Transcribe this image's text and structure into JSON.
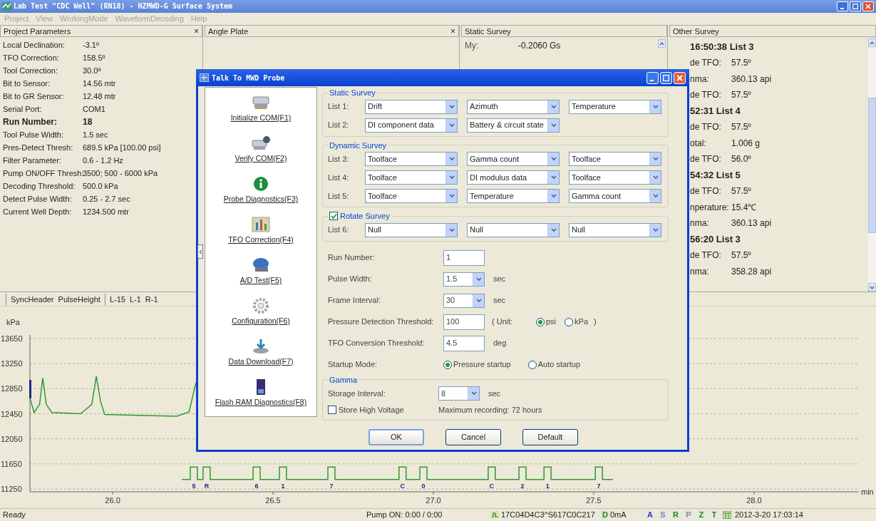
{
  "window": {
    "title": "Lab Test \"CDC Well\" (RN18) - HZMWD-G Surface System"
  },
  "menu": [
    "Project",
    "View",
    "WorkingMode",
    "WaveformDecoding",
    "Help"
  ],
  "project_parameters": {
    "title": "Project Parameters",
    "close": "×",
    "rows": [
      {
        "label": "Local Declination:",
        "value": "-3.1º",
        "bold": false
      },
      {
        "label": "TFO Correction:",
        "value": "158.5º",
        "bold": false
      },
      {
        "label": "Tool Correction:",
        "value": "30.0º",
        "bold": false
      },
      {
        "label": "Bit to Sensor:",
        "value": "14.56 mtr",
        "bold": false
      },
      {
        "label": "Bit to GR Sensor:",
        "value": "12.48 mtr",
        "bold": false
      },
      {
        "label": "Serial Port:",
        "value": "COM1",
        "bold": false
      },
      {
        "label": "Run Number:",
        "value": "18",
        "bold": true
      },
      {
        "label": "Tool Pulse Width:",
        "value": "1.5 sec",
        "bold": false
      },
      {
        "label": "Pres-Detect Thresh:",
        "value": "689.5 kPa [100.00 psi]",
        "bold": false
      },
      {
        "label": "Filter Parameter:",
        "value": "0.6 - 1.2 Hz",
        "bold": false
      },
      {
        "label": "Pump ON/OFF Thresh:",
        "value": "3500; 500 - 6000 kPa",
        "bold": false
      },
      {
        "label": "Decoding Threshold:",
        "value": "500.0 kPa",
        "bold": false
      },
      {
        "label": "Detect Pulse Width:",
        "value": "0.25 - 2.7 sec",
        "bold": false
      },
      {
        "label": "Current Well Depth:",
        "value": "1234.500 mtr",
        "bold": false
      }
    ]
  },
  "angle_plate": {
    "title": "Angle Plate",
    "close": "×"
  },
  "static_survey": {
    "title": "Static Survey",
    "rows": [
      {
        "label": "My:",
        "value": "-0.2060 Gs"
      }
    ]
  },
  "other_survey": {
    "title": "Other Survey",
    "entries": [
      {
        "kind": "header",
        "text": "16:50:38 List 3"
      },
      {
        "kind": "value",
        "label": "de TFO:",
        "value": "57.5º"
      },
      {
        "kind": "value",
        "label": "nma:",
        "value": "360.13 api"
      },
      {
        "kind": "value",
        "label": "de TFO:",
        "value": "57.5º"
      },
      {
        "kind": "header",
        "text": "52:31 List 4"
      },
      {
        "kind": "value",
        "label": "de TFO:",
        "value": "57.5º"
      },
      {
        "kind": "value",
        "label": "otal:",
        "value": "1.006 g"
      },
      {
        "kind": "value",
        "label": "de TFO:",
        "value": "56.0º"
      },
      {
        "kind": "header",
        "text": "54:32 List 5"
      },
      {
        "kind": "value",
        "label": "de TFO:",
        "value": "57.5º"
      },
      {
        "kind": "value",
        "label": "nperature:",
        "value": "15.4℃"
      },
      {
        "kind": "value",
        "label": "nma:",
        "value": "360.13 api"
      },
      {
        "kind": "header",
        "text": "56:20 List 3"
      },
      {
        "kind": "value",
        "label": "de TFO:",
        "value": "57.5º"
      },
      {
        "kind": "value",
        "label": "nma:",
        "value": "358.28 api"
      }
    ]
  },
  "chart_panel": {
    "legend": [
      "SyncHeader",
      "PulseHeight",
      "L-15",
      "L-1",
      "R-1"
    ],
    "chart_data": {
      "type": "line",
      "grid": true,
      "xlabel": "min",
      "ylabel": "kPa",
      "xlim": [
        25.742,
        28.327
      ],
      "ylim": [
        11250,
        13650
      ],
      "xticks": [
        {
          "value": 26,
          "label": "26.0"
        },
        {
          "value": 26.5,
          "label": "26.5"
        },
        {
          "value": 27,
          "label": "27.0"
        },
        {
          "value": 27.5,
          "label": "27.5"
        },
        {
          "value": 28,
          "label": "28.0"
        }
      ],
      "yticks": [
        13650,
        13250,
        12850,
        12450,
        12050,
        11650,
        11250
      ],
      "x": [
        25.742,
        25.755,
        25.772,
        25.782,
        25.793,
        25.81,
        25.9,
        25.935,
        25.949,
        25.962,
        25.975,
        26.1,
        26.2,
        26.238,
        26.26
      ],
      "series": [
        {
          "color": "#2f9a2f",
          "values": [
            12700,
            12470,
            12600,
            13020,
            12600,
            12470,
            12450,
            12600,
            13050,
            12650,
            12440,
            12420,
            12410,
            12480,
            12950
          ]
        },
        {
          "color": "#2f9a2f",
          "x": [
            26.216,
            26.242,
            26.242,
            26.264,
            26.264,
            26.282,
            26.282,
            26.304,
            26.304,
            26.438,
            26.438,
            26.46,
            26.46,
            26.52,
            26.52,
            26.542,
            26.542,
            26.671,
            26.671,
            26.693,
            26.693,
            26.893,
            26.893,
            26.915,
            26.915,
            26.958,
            26.958,
            26.98,
            26.98,
            27.171,
            27.171,
            27.193,
            27.193,
            27.267,
            27.267,
            27.289,
            27.289,
            27.345,
            27.345,
            27.367,
            27.367,
            27.505,
            27.505,
            27.527,
            27.527,
            27.56
          ],
          "values": [
            11400,
            11400,
            11600,
            11600,
            11400,
            11400,
            11600,
            11600,
            11400,
            11400,
            11600,
            11600,
            11400,
            11400,
            11600,
            11600,
            11400,
            11400,
            11600,
            11600,
            11400,
            11400,
            11600,
            11600,
            11400,
            11400,
            11600,
            11600,
            11400,
            11400,
            11600,
            11600,
            11400,
            11400,
            11600,
            11600,
            11400,
            11400,
            11600,
            11600,
            11400,
            11400,
            11600,
            11600,
            11400,
            11400
          ]
        }
      ],
      "annotations": [
        "5",
        "R",
        "6",
        "1",
        "7",
        "C",
        "0",
        "C",
        "2",
        "1",
        "7"
      ]
    }
  },
  "dialog": {
    "title": "Talk To MWD Probe",
    "nav": [
      "Initialize COM(F1)",
      "Verify COM(F2)",
      "Probe Diagnostics(F3)",
      "TFO Correction(F4)",
      "A/D Test(F5)",
      "Configuration(F6)",
      "Data Download(F7)",
      "Flash RAM Diagnostics(F8)"
    ],
    "static_survey": {
      "title": "Static Survey",
      "lists": [
        {
          "label": "List 1:",
          "options": [
            "Drift",
            "Azimuth",
            "Temperature"
          ]
        },
        {
          "label": "List 2:",
          "options": [
            "DI component data",
            "Battery & circuit state"
          ]
        }
      ]
    },
    "dynamic_survey": {
      "title": "Dynamic Survey",
      "lists": [
        {
          "label": "List 3:",
          "options": [
            "Toolface",
            "Gamma count",
            "Toolface"
          ]
        },
        {
          "label": "List 4:",
          "options": [
            "Toolface",
            "DI modulus data",
            "Toolface"
          ]
        },
        {
          "label": "List 5:",
          "options": [
            "Toolface",
            "Temperature",
            "Gamma count"
          ]
        }
      ]
    },
    "rotate_survey": {
      "title": "Rotate Survey",
      "checked": true,
      "lists": [
        {
          "label": "List 6:",
          "options": [
            "Null",
            "Null",
            "Null"
          ]
        }
      ]
    },
    "run_number": {
      "label": "Run Number:",
      "value": "1"
    },
    "pulse_width": {
      "label": "Pulse Width:",
      "value": "1.5",
      "unit": "sec"
    },
    "frame_interval": {
      "label": "Frame Interval:",
      "value": "30",
      "unit": "sec"
    },
    "pressure": {
      "label": "Pressure Detection Threshold:",
      "value": "100",
      "unit_open": "( Unit:",
      "options": [
        {
          "label": "psi",
          "selected": true
        },
        {
          "label": "kPa",
          "selected": false
        }
      ],
      "unit_close": ")"
    },
    "tfo": {
      "label": "TFO Conversion Threshold:",
      "value": "4.5",
      "unit": "deg"
    },
    "startup": {
      "label": "Startup Mode:",
      "options": [
        {
          "label": "Pressure startup",
          "selected": true
        },
        {
          "label": "Auto startup",
          "selected": false
        }
      ]
    },
    "gamma": {
      "title": "Gamma",
      "storage": {
        "label": "Storage Interval:",
        "value": "8",
        "unit": "sec"
      },
      "store_high_voltage": {
        "label": "Store High Voltage",
        "checked": false
      },
      "max_recording": "Maximum recording: 72 hours"
    },
    "buttons": [
      "OK",
      "Cancel",
      "Default"
    ]
  },
  "status_bar": {
    "text": "Ready",
    "pump": "Pump ON: 0:00 / 0:00",
    "code": "17C04D4C3^S617C0C217",
    "current_flag": "D",
    "current": "0mA",
    "indicators": [
      {
        "label": "A",
        "color": "#1f3fc0"
      },
      {
        "label": "S",
        "color": "#7a86a8"
      },
      {
        "label": "R",
        "color": "#1c8a1c"
      },
      {
        "label": "P",
        "color": "#8a8a8a"
      },
      {
        "label": "Z",
        "color": "#1c8a1c"
      },
      {
        "label": "T",
        "color": "#1c8a1c"
      }
    ],
    "datetime": "2012-3-20 17:03:14"
  }
}
